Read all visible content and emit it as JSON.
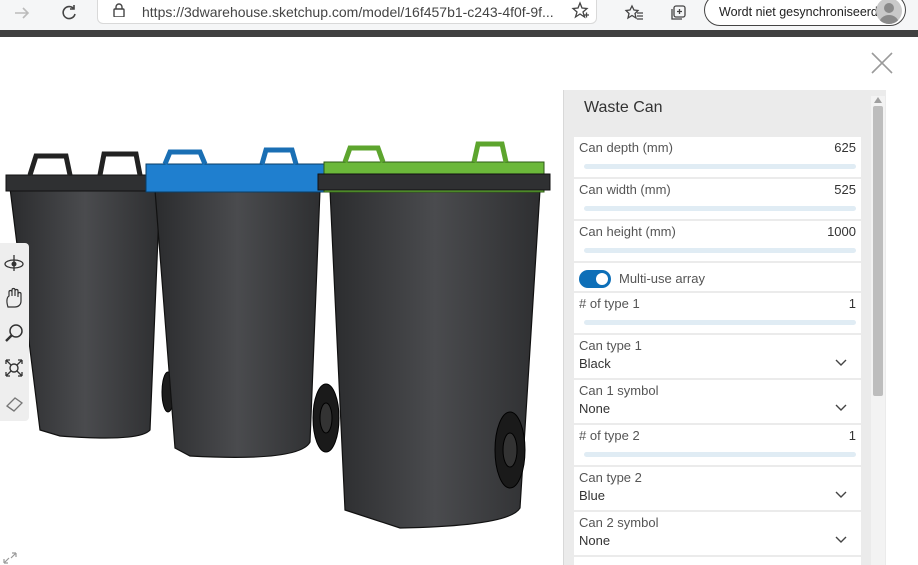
{
  "browser": {
    "url": "https://3dwarehouse.sketchup.com/model/16f457b1-c243-4f0f-9f...",
    "sync_label": "Wordt niet gesynchroniseerd"
  },
  "panel": {
    "title": "Waste Can",
    "sliders": [
      {
        "label": "Can depth (mm)",
        "value": "625",
        "fraction": 0.0
      },
      {
        "label": "Can width (mm)",
        "value": "525",
        "fraction": 0.0
      },
      {
        "label": "Can height (mm)",
        "value": "1000",
        "fraction": 0.6
      }
    ],
    "toggle": {
      "label": "Multi-use array",
      "on": true
    },
    "type1": {
      "label": "# of type 1",
      "value": "1",
      "fraction": 0.0
    },
    "can_type1": {
      "label": "Can type 1",
      "value": "Black"
    },
    "can1_symbol": {
      "label": "Can 1 symbol",
      "value": "None"
    },
    "type2": {
      "label": "# of type 2",
      "value": "1",
      "fraction": 0.0
    },
    "can_type2": {
      "label": "Can type 2",
      "value": "Blue"
    },
    "can2_symbol": {
      "label": "Can 2 symbol",
      "value": "None"
    }
  },
  "tools": [
    "orbit-icon",
    "pan-icon",
    "zoom-icon",
    "zoom-extents-icon",
    "eraser-icon"
  ],
  "colors": {
    "accent": "#0d6fb8",
    "bin_body": "#3a3b3d",
    "lid_black": "#2f3032",
    "lid_blue": "#1f7fcf",
    "lid_green": "#6bb83a"
  }
}
